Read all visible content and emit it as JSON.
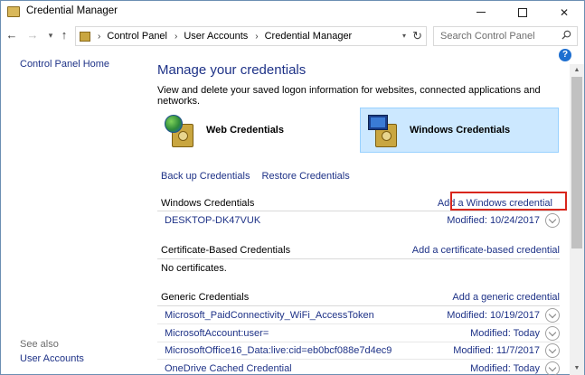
{
  "window": {
    "title": "Credential Manager"
  },
  "nav": {
    "breadcrumbs": [
      "Control Panel",
      "User Accounts",
      "Credential Manager"
    ],
    "search_placeholder": "Search Control Panel"
  },
  "sidebar": {
    "home": "Control Panel Home",
    "see_also_label": "See also",
    "see_also_items": [
      "User Accounts"
    ]
  },
  "main": {
    "heading": "Manage your credentials",
    "subtitle": "View and delete your saved logon information for websites, connected applications and networks.",
    "tiles": {
      "web": "Web Credentials",
      "windows": "Windows Credentials"
    },
    "links": {
      "backup": "Back up Credentials",
      "restore": "Restore Credentials"
    },
    "sections": {
      "windows": {
        "title": "Windows Credentials",
        "add": "Add a Windows credential",
        "items": [
          {
            "name": "DESKTOP-DK47VUK",
            "modified": "Modified:  10/24/2017"
          }
        ]
      },
      "certificate": {
        "title": "Certificate-Based Credentials",
        "add": "Add a certificate-based credential",
        "empty": "No certificates."
      },
      "generic": {
        "title": "Generic Credentials",
        "add": "Add a generic credential",
        "items": [
          {
            "name": "Microsoft_PaidConnectivity_WiFi_AccessToken",
            "modified": "Modified:  10/19/2017"
          },
          {
            "name": "MicrosoftAccount:user=",
            "modified": "Modified:  Today"
          },
          {
            "name": "MicrosoftOffice16_Data:live:cid=eb0bcf088e7d4ec9",
            "modified": "Modified:  11/7/2017"
          },
          {
            "name": "OneDrive Cached Credential",
            "modified": "Modified:  Today"
          }
        ]
      }
    }
  },
  "colors": {
    "link": "#1e3287",
    "selected_tile_bg": "#cce8ff",
    "highlight_box": "#d9261c"
  }
}
